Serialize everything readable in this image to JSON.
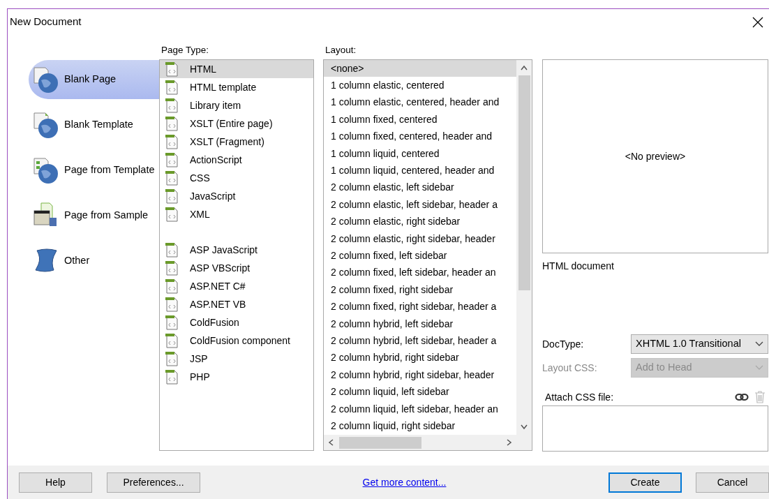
{
  "window": {
    "title": "New Document"
  },
  "categories": [
    {
      "label": "Blank Page",
      "kind": "blank-page",
      "selected": true
    },
    {
      "label": "Blank Template",
      "kind": "blank-template",
      "selected": false
    },
    {
      "label": "Page from Template",
      "kind": "page-from-template",
      "selected": false
    },
    {
      "label": "Page from Sample",
      "kind": "page-from-sample",
      "selected": false
    },
    {
      "label": "Other",
      "kind": "other",
      "selected": false
    }
  ],
  "page_type": {
    "label": "Page Type:",
    "groups": [
      [
        {
          "label": "HTML",
          "selected": true
        },
        {
          "label": "HTML template",
          "selected": false
        },
        {
          "label": "Library item",
          "selected": false
        },
        {
          "label": "XSLT (Entire page)",
          "selected": false
        },
        {
          "label": "XSLT (Fragment)",
          "selected": false
        },
        {
          "label": "ActionScript",
          "selected": false
        },
        {
          "label": "CSS",
          "selected": false
        },
        {
          "label": "JavaScript",
          "selected": false
        },
        {
          "label": "XML",
          "selected": false
        }
      ],
      [
        {
          "label": "ASP JavaScript",
          "selected": false
        },
        {
          "label": "ASP VBScript",
          "selected": false
        },
        {
          "label": "ASP.NET C#",
          "selected": false
        },
        {
          "label": "ASP.NET VB",
          "selected": false
        },
        {
          "label": "ColdFusion",
          "selected": false
        },
        {
          "label": "ColdFusion component",
          "selected": false
        },
        {
          "label": "JSP",
          "selected": false
        },
        {
          "label": "PHP",
          "selected": false
        }
      ]
    ]
  },
  "layout": {
    "label": "Layout:",
    "items": [
      {
        "label": "<none>",
        "selected": true
      },
      {
        "label": "1 column elastic, centered",
        "selected": false
      },
      {
        "label": "1 column elastic, centered, header and",
        "selected": false
      },
      {
        "label": "1 column fixed, centered",
        "selected": false
      },
      {
        "label": "1 column fixed, centered, header and",
        "selected": false
      },
      {
        "label": "1 column liquid, centered",
        "selected": false
      },
      {
        "label": "1 column liquid, centered, header and",
        "selected": false
      },
      {
        "label": "2 column elastic, left sidebar",
        "selected": false
      },
      {
        "label": "2 column elastic, left sidebar, header a",
        "selected": false
      },
      {
        "label": "2 column elastic, right sidebar",
        "selected": false
      },
      {
        "label": "2 column elastic, right sidebar, header",
        "selected": false
      },
      {
        "label": "2 column fixed, left sidebar",
        "selected": false
      },
      {
        "label": "2 column fixed, left sidebar, header an",
        "selected": false
      },
      {
        "label": "2 column fixed, right sidebar",
        "selected": false
      },
      {
        "label": "2 column fixed, right sidebar, header a",
        "selected": false
      },
      {
        "label": "2 column hybrid, left sidebar",
        "selected": false
      },
      {
        "label": "2 column hybrid, left sidebar, header a",
        "selected": false
      },
      {
        "label": "2 column hybrid, right sidebar",
        "selected": false
      },
      {
        "label": "2 column hybrid, right sidebar, header",
        "selected": false
      },
      {
        "label": "2 column liquid, left sidebar",
        "selected": false
      },
      {
        "label": "2 column liquid, left sidebar, header an",
        "selected": false
      },
      {
        "label": "2 column liquid, right sidebar",
        "selected": false
      }
    ]
  },
  "preview": {
    "text": "<No preview>",
    "description": "HTML document"
  },
  "fields": [
    {
      "label": "DocType:",
      "value": "XHTML 1.0 Transitional",
      "disabled": false
    },
    {
      "label": "Layout CSS:",
      "value": "Add to Head",
      "disabled": true
    }
  ],
  "attach_css": {
    "label": "Attach CSS file:"
  },
  "footer": {
    "help": "Help",
    "preferences": "Preferences...",
    "link": "Get more content...",
    "create": "Create",
    "cancel": "Cancel"
  }
}
